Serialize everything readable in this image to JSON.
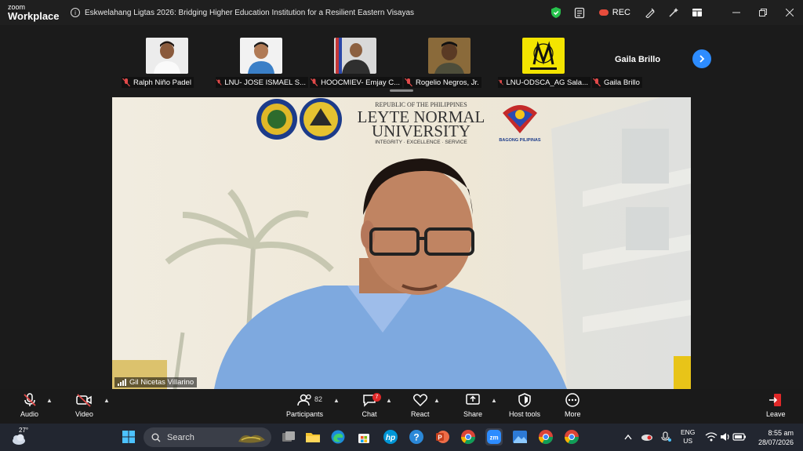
{
  "titlebar": {
    "brand_top": "zoom",
    "brand_bottom": "Workplace",
    "meeting_title": "Eskwelahang Ligtas 2026: Bridging Higher Education Institution for a Resilient Eastern Visayas",
    "rec_label": "REC"
  },
  "participants_strip": {
    "tiles": [
      {
        "name": "Ralph Niño Padel",
        "photo_bg": "#e9e9e9"
      },
      {
        "name": "LNU- JOSE ISMAEL S...",
        "photo_bg": "#f0f0f0"
      },
      {
        "name": "HOOCMIEV- Emjay C...",
        "photo_bg": "#d8d8d8"
      },
      {
        "name": "Rogelio Negros, Jr.",
        "photo_bg": "#8a6a3a"
      },
      {
        "name": "LNU-ODSCA_AG Sala...",
        "photo_bg": "#f3e400"
      },
      {
        "name": "Gaila Brillo"
      }
    ],
    "name_only_tile": "Gaila Brillo"
  },
  "main_video": {
    "header_line1": "REPUBLIC OF THE PHILIPPINES",
    "header_line2": "LEYTE NORMAL",
    "header_line3": "UNIVERSITY",
    "header_line4": "INTEGRITY  ·  EXCELLENCE  ·  SERVICE",
    "bagong_label": "BAGONG PILIPINAS",
    "speaker_name": "Gil Nicetas Villarino"
  },
  "toolbar": {
    "audio": "Audio",
    "video": "Video",
    "participants": "Participants",
    "participants_count": "82",
    "chat": "Chat",
    "chat_badge": "7",
    "react": "React",
    "share": "Share",
    "host_tools": "Host tools",
    "more": "More",
    "leave": "Leave"
  },
  "taskbar": {
    "weather_temp": "27°",
    "search_placeholder": "Search",
    "lang_line1": "ENG",
    "lang_line2": "US",
    "time": "8:55 am",
    "date": "28/07/2026"
  },
  "colors": {
    "accent": "#2d8cff",
    "leave_red": "#e02828",
    "shield_green": "#27c24c"
  }
}
